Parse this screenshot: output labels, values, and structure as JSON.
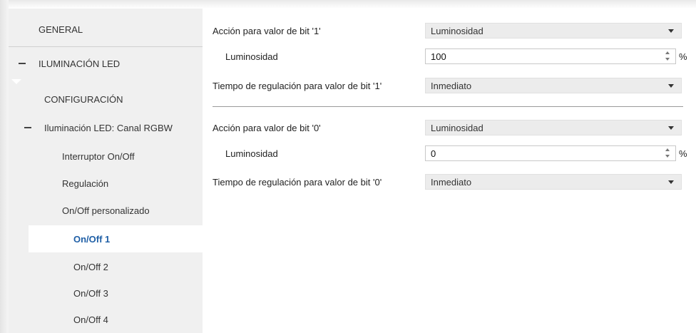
{
  "sidebar": {
    "items": [
      {
        "label": "GENERAL"
      },
      {
        "label": "ILUMINACIÓN LED"
      },
      {
        "label": "CONFIGURACIÓN"
      },
      {
        "label": "Iluminación LED: Canal RGBW"
      },
      {
        "label": "Interruptor On/Off"
      },
      {
        "label": "Regulación"
      },
      {
        "label": "On/Off personalizado"
      },
      {
        "label": "On/Off 1"
      },
      {
        "label": "On/Off 2"
      },
      {
        "label": "On/Off 3"
      },
      {
        "label": "On/Off 4"
      }
    ],
    "selected": "On/Off 1"
  },
  "main": {
    "bit1": {
      "action_label": "Acción para valor de bit '1'",
      "action_value": "Luminosidad",
      "brightness_label": "Luminosidad",
      "brightness_value": "100",
      "unit": "%",
      "time_label": "Tiempo de regulación para valor de bit '1'",
      "time_value": "Inmediato"
    },
    "bit0": {
      "action_label": "Acción para valor de bit '0'",
      "action_value": "Luminosidad",
      "brightness_label": "Luminosidad",
      "brightness_value": "0",
      "unit": "%",
      "time_label": "Tiempo de regulación para valor de bit '0'",
      "time_value": "Inmediato"
    }
  },
  "colors": {
    "sidebar_bg": "#f0f0f0",
    "selected_text": "#1f5fa6",
    "select_bg": "#ececec"
  }
}
